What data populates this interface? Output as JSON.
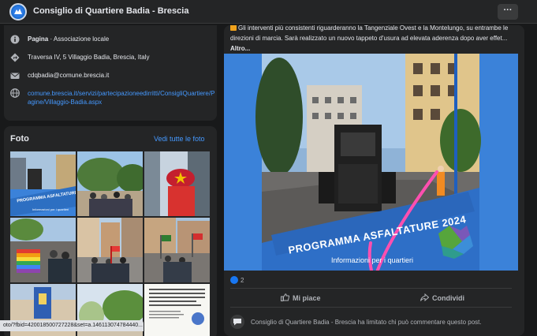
{
  "header": {
    "title": "Consiglio di Quartiere Badia - Brescia",
    "more_label": "···"
  },
  "intro": {
    "category_label": "Pagina",
    "category_value": " · Associazione locale",
    "address": "Traversa IV, 5 Villaggio Badia, Brescia, Italy",
    "email": "cdqbadia@comune.brescia.it",
    "website": "comune.brescia.it/servizi/partecipazioneedirritti/ConsigliQuartiere/Pagine/Villaggio-Badia.aspx"
  },
  "photos": {
    "title": "Foto",
    "see_all": "Vedi tutte le foto",
    "thumb1_banner": "PROGRAMMA ASFALTATURE 2024",
    "thumb1_sub": "Informazioni per i quartieri"
  },
  "status_bar": {
    "url": "oto/?fbid=420018500727228&set=a.146113074784440..."
  },
  "post": {
    "text": "Gli interventi più consistenti riguarderanno la Tangenziale Ovest e la Montelungo, su entrambe le direzioni di marcia. Sarà realizzato un nuovo tappeto d'usura ad elevata aderenza dopo aver effet...",
    "more_label": "Altro...",
    "banner_title": "PROGRAMMA ASFALTATURE 2024",
    "banner_sub": "Informazioni per i quartieri",
    "reaction_count": "2",
    "like_label": "Mi piace",
    "share_label": "Condividi",
    "comment_notice": "Consiglio di Quartiere Badia - Brescia ha limitato chi può commentare questo post."
  },
  "colors": {
    "background": "#18191a",
    "card": "#242526",
    "link": "#4599ff",
    "accent": "#1877f2",
    "arrow": "#ff4fb0"
  }
}
